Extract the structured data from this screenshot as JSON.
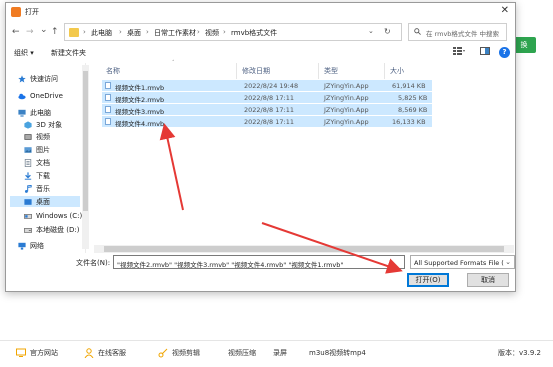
{
  "background_app": {
    "right_button_label": "换",
    "footer": {
      "official_site": "官方网站",
      "online_service": "在线客服",
      "links": [
        "视频剪辑",
        "视频压缩",
        "录屏",
        "m3u8视频转mp4"
      ],
      "version_label": "版本：v3.9.2"
    }
  },
  "dialog": {
    "title": "打开",
    "close_glyph": "✕",
    "nav": {
      "back": "←",
      "forward": "→",
      "recent": "⌄",
      "up": "↑",
      "breadcrumbs": [
        "此电脑",
        "桌面",
        "日常工作素材",
        "视频",
        "rmvb格式文件"
      ],
      "separator": "›",
      "refresh": "↻",
      "search_placeholder": "在 rmvb格式文件 中搜索"
    },
    "toolbar": {
      "organize": "组织 ▾",
      "new_folder": "新建文件夹"
    },
    "sidebar": [
      {
        "label": "快速访问",
        "icon": "star-icon",
        "color": "#2a7bd3"
      },
      {
        "label": "OneDrive",
        "icon": "cloud-icon",
        "color": "#1a73e8"
      },
      {
        "label": "此电脑",
        "icon": "computer-icon",
        "color": "#3b82c4"
      },
      {
        "label": "3D 对象",
        "icon": "cube-icon",
        "color": "#4aa3df"
      },
      {
        "label": "视频",
        "icon": "video-icon",
        "color": "#555555"
      },
      {
        "label": "图片",
        "icon": "picture-icon",
        "color": "#5b9bd5"
      },
      {
        "label": "文档",
        "icon": "document-icon",
        "color": "#7f8c9a"
      },
      {
        "label": "下载",
        "icon": "download-icon",
        "color": "#2a7bd3"
      },
      {
        "label": "音乐",
        "icon": "music-icon",
        "color": "#2a7bd3"
      },
      {
        "label": "桌面",
        "icon": "desktop-icon",
        "color": "#2a7bd3"
      },
      {
        "label": "Windows (C:)",
        "icon": "drive-icon",
        "color": "#2a7bd3"
      },
      {
        "label": "本地磁盘 (D:)",
        "icon": "drive-icon",
        "color": "#666666"
      },
      {
        "label": "网络",
        "icon": "network-icon",
        "color": "#2a7bd3"
      }
    ],
    "columns": [
      "名称",
      "修改日期",
      "类型",
      "大小"
    ],
    "files": [
      {
        "name": "视频文件1.rmvb",
        "date": "2022/8/24 19:48",
        "type": "JZYingYin.App",
        "size": "61,914 KB"
      },
      {
        "name": "视频文件2.rmvb",
        "date": "2022/8/8 17:11",
        "type": "JZYingYin.App",
        "size": "5,825 KB"
      },
      {
        "name": "视频文件3.rmvb",
        "date": "2022/8/8 17:11",
        "type": "JZYingYin.App",
        "size": "8,569 KB"
      },
      {
        "name": "视频文件4.rmvb",
        "date": "2022/8/8 17:11",
        "type": "JZYingYin.App",
        "size": "16,133 KB"
      }
    ],
    "filename_label": "文件名(N):",
    "filename_value": "\"视频文件2.rmvb\" \"视频文件3.rmvb\" \"视频文件4.rmvb\" \"视频文件1.rmvb\"",
    "filter_value": "All Supported Formats File (",
    "open_button": "打开(O)",
    "cancel_button": "取消"
  },
  "colors": {
    "selection": "#cce8ff",
    "annotation_arrow": "#e53935",
    "primary_border": "#0078d7"
  }
}
